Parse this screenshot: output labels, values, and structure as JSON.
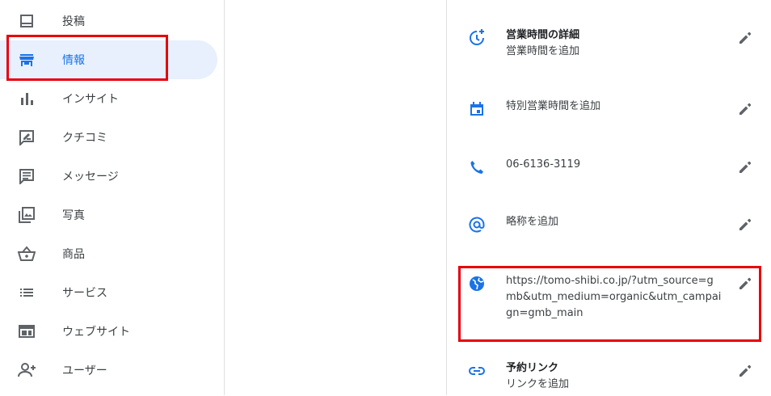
{
  "sidebar": {
    "items": [
      {
        "label": "投稿",
        "icon": "post-icon"
      },
      {
        "label": "情報",
        "icon": "storefront-icon",
        "active": true
      },
      {
        "label": "インサイト",
        "icon": "bar-chart-icon"
      },
      {
        "label": "クチコミ",
        "icon": "review-icon"
      },
      {
        "label": "メッセージ",
        "icon": "message-icon"
      },
      {
        "label": "写真",
        "icon": "photo-library-icon"
      },
      {
        "label": "商品",
        "icon": "basket-icon"
      },
      {
        "label": "サービス",
        "icon": "list-icon"
      },
      {
        "label": "ウェブサイト",
        "icon": "website-icon"
      },
      {
        "label": "ユーザー",
        "icon": "add-user-icon"
      }
    ]
  },
  "details": {
    "hours": {
      "title": "営業時間の詳細",
      "value": "営業時間を追加"
    },
    "special_hours": {
      "value": "特別営業時間を追加"
    },
    "phone": {
      "value": "06-6136-3119"
    },
    "short_name": {
      "value": "略称を追加"
    },
    "website": {
      "value": "https://tomo-shibi.co.jp/?utm_source=gmb&utm_medium=organic&utm_campaign=gmb_main"
    },
    "booking": {
      "title": "予約リンク",
      "value": "リンクを追加"
    }
  },
  "colors": {
    "accent": "#1a73e8",
    "highlight": "#e8000b",
    "active_bg": "#e8f0fe"
  }
}
